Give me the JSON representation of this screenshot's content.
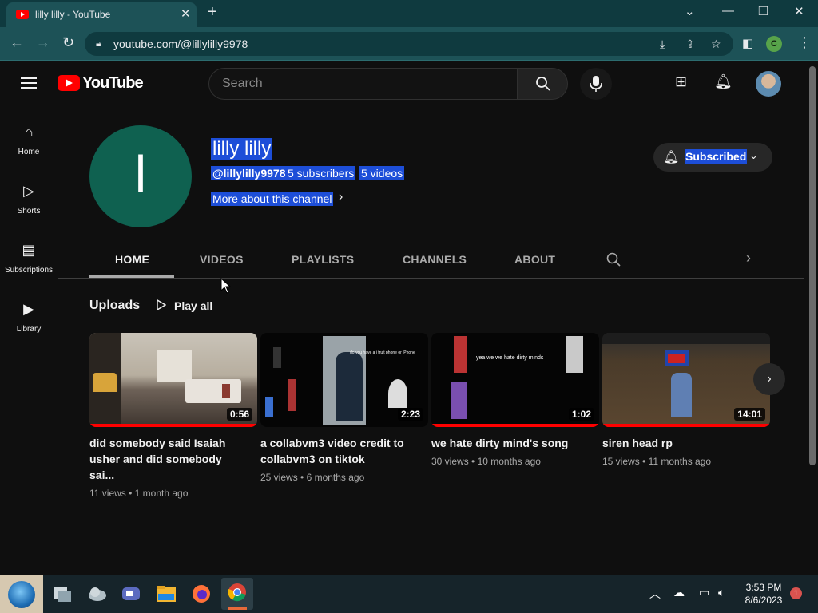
{
  "browser": {
    "tab_title": "lilly lilly - YouTube",
    "url": "youtube.com/@lillylilly9978",
    "profile_initial": "C"
  },
  "header": {
    "logo_text": "YouTube",
    "search_placeholder": "Search"
  },
  "sidebar": {
    "items": [
      {
        "label": "Home",
        "icon": "home-icon"
      },
      {
        "label": "Shorts",
        "icon": "shorts-icon"
      },
      {
        "label": "Subscriptions",
        "icon": "subscriptions-icon"
      },
      {
        "label": "Library",
        "icon": "library-icon"
      }
    ]
  },
  "channel": {
    "avatar_letter": "l",
    "name": "lilly lilly",
    "handle": "@lillylilly9978",
    "subscribers": "5 subscribers",
    "videos": "5 videos",
    "more": "More about this channel",
    "subscribe_label": "Subscribed"
  },
  "tabs": [
    "HOME",
    "VIDEOS",
    "PLAYLISTS",
    "CHANNELS",
    "ABOUT"
  ],
  "uploads": {
    "title": "Uploads",
    "play_all": "Play all",
    "videos": [
      {
        "title": "did somebody said Isaiah usher and did somebody sai...",
        "duration": "0:56",
        "views": "11 views",
        "age": "1 month ago"
      },
      {
        "title": "a collabvm3 video credit to collabvm3 on tiktok",
        "duration": "2:23",
        "views": "25 views",
        "age": "6 months ago",
        "overlay": "do you have a i fruit phone or iPhone"
      },
      {
        "title": "we hate dirty mind's song",
        "duration": "1:02",
        "views": "30 views",
        "age": "10 months ago",
        "overlay": "yea we we hate dirty minds"
      },
      {
        "title": "siren head rp",
        "duration": "14:01",
        "views": "15 views",
        "age": "11 months ago"
      }
    ]
  },
  "taskbar": {
    "time": "3:53 PM",
    "date": "8/6/2023",
    "notifications": "1"
  },
  "colors": {
    "background": "#0f0f0f",
    "accent": "#ff0000",
    "selection": "#1d4ed8",
    "chrome_frame": "#0f3a3f"
  }
}
